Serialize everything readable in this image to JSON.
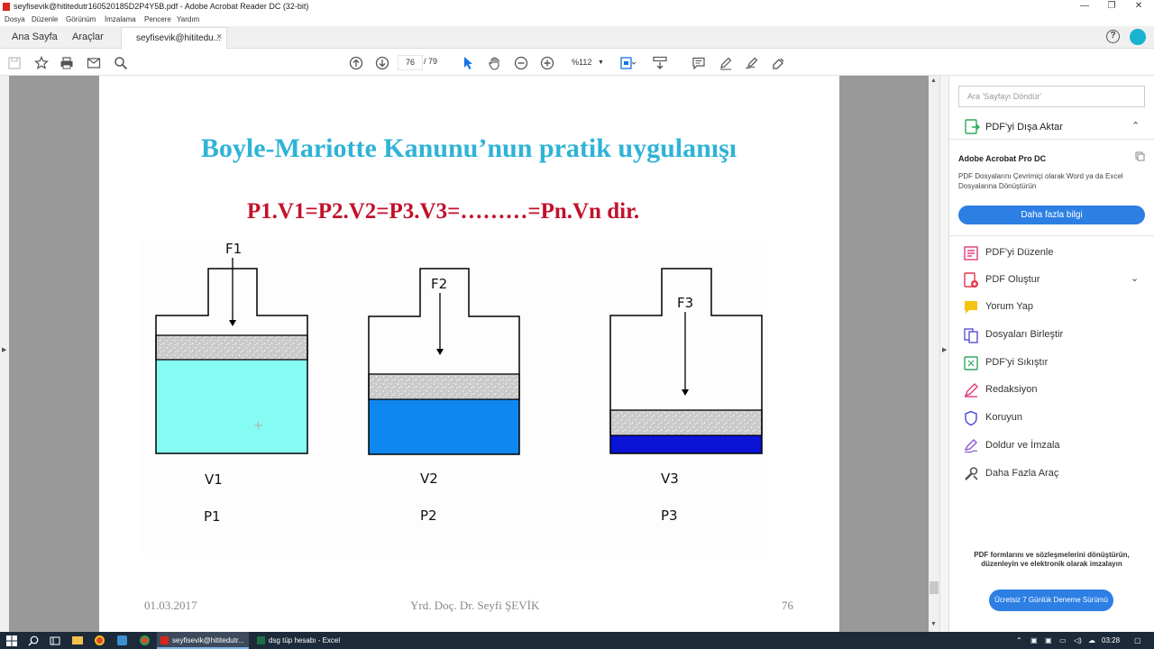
{
  "window": {
    "title": "seyfisevik@hititedutr160520185D2P4Y5B.pdf - Adobe Acrobat Reader DC (32-bit)",
    "minimize": "—",
    "restore": "❐",
    "close": "✕"
  },
  "menu": [
    "Dosya",
    "Düzenle",
    "Görünüm",
    "İmzalama",
    "Pencere",
    "Yardım"
  ],
  "tabs": {
    "home": "Ana Sayfa",
    "tools": "Araçlar",
    "doc": "seyfisevik@hititedu...",
    "close": "×",
    "help": "?"
  },
  "toolbar": {
    "page_current": "76",
    "page_total": "/ 79",
    "zoom": "%112"
  },
  "slide": {
    "title": "Boyle-Mariotte Kanunu’nun pratik uygulanışı",
    "equation": "P1.V1=P2.V2=P3.V3=………=Pn.Vn dir.",
    "cylinders": [
      {
        "force": "F1",
        "volume": "V1",
        "pressure": "P1",
        "liquid_color": "#86fbf4"
      },
      {
        "force": "F2",
        "volume": "V2",
        "pressure": "P2",
        "liquid_color": "#0f87f0"
      },
      {
        "force": "F3",
        "volume": "V3",
        "pressure": "P3",
        "liquid_color": "#0a13d6"
      }
    ],
    "footer_date": "01.03.2017",
    "footer_author": "Yrd. Doç. Dr. Seyfi ŞEVİK",
    "footer_page": "76"
  },
  "panel": {
    "search_placeholder": "Ara 'Sayfayı Döndür'",
    "export": "PDF'yi Dışa Aktar",
    "promo_title": "Adobe Acrobat Pro DC",
    "promo_desc": "PDF Dosyalarını Çevrimiçi olarak Word ya da Excel Dosyalarına Dönüştürün",
    "promo_button": "Daha fazla bilgi",
    "tools": [
      {
        "label": "PDF'yi Düzenle",
        "color": "#e0397b"
      },
      {
        "label": "PDF Oluştur",
        "color": "#e2374b"
      },
      {
        "label": "Yorum Yap",
        "color": "#f2c40f"
      },
      {
        "label": "Dosyaları Birleştir",
        "color": "#5c4fd6"
      },
      {
        "label": "PDF'yi Sıkıştır",
        "color": "#2faa5c"
      },
      {
        "label": "Redaksiyon",
        "color": "#e0397b"
      },
      {
        "label": "Koruyun",
        "color": "#4d53d8"
      },
      {
        "label": "Doldur ve İmzala",
        "color": "#8a56d8"
      },
      {
        "label": "Daha Fazla Araç",
        "color": "#555555"
      }
    ],
    "bottom_note": "PDF formlarını ve sözleşmelerini dönüştürün, düzenleyin ve elektronik olarak imzalayın",
    "trial_button": "Ücretsiz 7 Günlük Deneme Sürümü"
  },
  "taskbar": {
    "acrobat_task": "seyfisevik@hititedutr...",
    "excel_task": "dsg tüp hesabı - Excel",
    "time": "03:28"
  }
}
